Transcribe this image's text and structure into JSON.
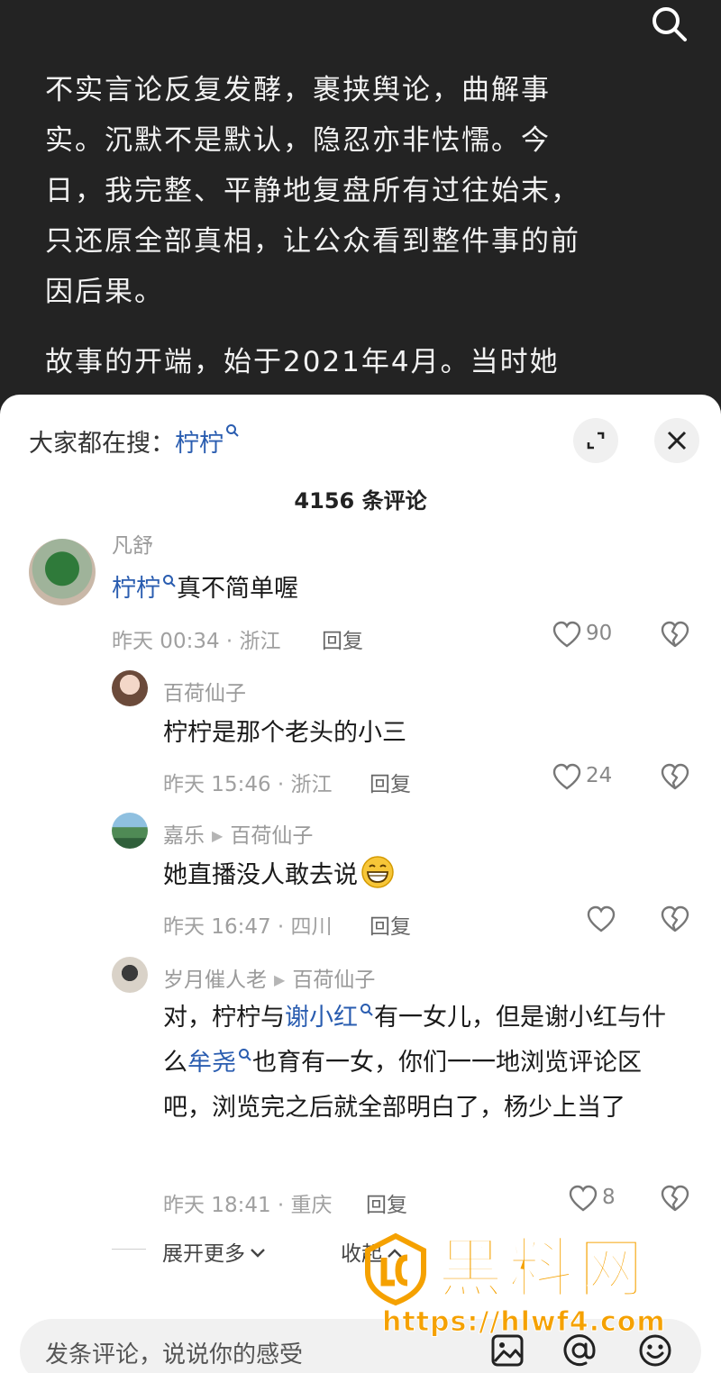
{
  "article": {
    "paragraphs": [
      "不实言论反复发酵，裹挟舆论，曲解事实。沉默不是默认，隐忍亦非怯懦。今日，我完整、平静地复盘所有过往始末，只还原全部真相，让公众看到整件事的前因后果。",
      "故事的开端，始于2021年4月。当时她"
    ]
  },
  "sheet": {
    "hot_prefix": "大家都在搜：",
    "hot_keyword": "柠柠",
    "comment_count": "4156 条评论"
  },
  "comments": [
    {
      "user": "凡舒",
      "link": "柠柠",
      "text": "真不简单喔",
      "meta": "昨天 00:34 · 浙江",
      "reply": "回复",
      "likes": "90"
    },
    {
      "user": "百荷仙子",
      "text": "柠柠是那个老头的小三",
      "meta": "昨天 15:46 · 浙江",
      "reply": "回复",
      "likes": "24"
    },
    {
      "user": "嘉乐",
      "reply_to": "百荷仙子",
      "text": "她直播没人敢去说",
      "emoji": "grinning-emoji",
      "meta": "昨天 16:47 · 四川",
      "reply": "回复",
      "likes": ""
    },
    {
      "user": "岁月催人老",
      "reply_to": "百荷仙子",
      "text_a": "对，柠柠与",
      "link_a": "谢小红",
      "text_b": "有一女儿，但是谢小红与什么",
      "link_b": "牟尧",
      "text_c": "也育有一女，你们一一地浏览评论区吧，浏览完之后就全部明白了，杨少上当了",
      "meta": "昨天 18:41 · 重庆",
      "reply": "回复",
      "likes": "8"
    }
  ],
  "more": {
    "expand_label": "展开更多",
    "fold_label": "收起"
  },
  "input": {
    "placeholder": "发条评论，说说你的感受"
  },
  "watermark": {
    "title": "黑料网",
    "url": "https://hlwf4.com"
  },
  "colors": {
    "link": "#2a5db0",
    "watermark": "#f5a100"
  }
}
